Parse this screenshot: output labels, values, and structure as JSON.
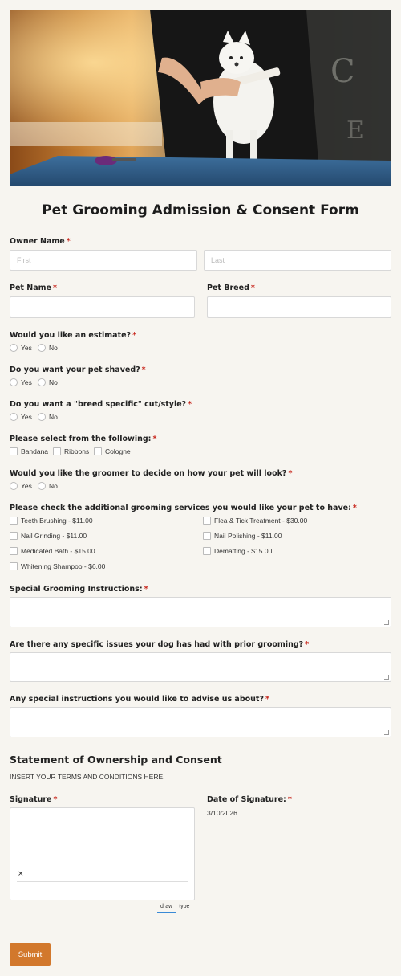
{
  "form": {
    "title": "Pet Grooming Admission & Consent Form",
    "required_mark": "*",
    "owner_name": {
      "label": "Owner Name",
      "first_placeholder": "First",
      "last_placeholder": "Last"
    },
    "pet_name": {
      "label": "Pet Name"
    },
    "pet_breed": {
      "label": "Pet Breed"
    },
    "estimate": {
      "label": "Would you like an estimate?",
      "options": [
        "Yes",
        "No"
      ]
    },
    "shaved": {
      "label": "Do you want your pet shaved?",
      "options": [
        "Yes",
        "No"
      ]
    },
    "breed_cut": {
      "label": "Do you want a \"breed specific\" cut/style?",
      "options": [
        "Yes",
        "No"
      ]
    },
    "select_following": {
      "label": "Please select from the following:",
      "options": [
        "Bandana",
        "Ribbons",
        "Cologne"
      ]
    },
    "groomer_decide": {
      "label": "Would you like the groomer to decide on how your pet will look?",
      "options": [
        "Yes",
        "No"
      ]
    },
    "additional_services": {
      "label": "Please check the additional grooming services you would like your pet to have:",
      "options": [
        "Teeth Brushing - $11.00",
        "Flea & Tick Treatment - $30.00",
        "Nail Grinding - $11.00",
        "Nail Polishing - $11.00",
        "Medicated Bath - $15.00",
        "Dematting - $15.00",
        "Whitening Shampoo - $6.00"
      ]
    },
    "special_grooming": {
      "label": "Special Grooming Instructions:"
    },
    "prior_issues": {
      "label": "Are there any specific issues your dog has had with prior grooming?"
    },
    "special_advise": {
      "label": "Any special instructions you would like to advise us about?"
    },
    "consent": {
      "title": "Statement of Ownership and Consent",
      "terms": "INSERT YOUR TERMS AND CONDITIONS HERE."
    },
    "signature": {
      "label": "Signature",
      "clear": "×",
      "tabs": [
        "draw",
        "type"
      ]
    },
    "date_of_signature": {
      "label": "Date of Signature:",
      "value": "3/10/2026"
    },
    "submit_label": "Submit"
  },
  "colors": {
    "accent": "#d2782c",
    "required": "#c8281e",
    "background": "#f7f5f0"
  }
}
